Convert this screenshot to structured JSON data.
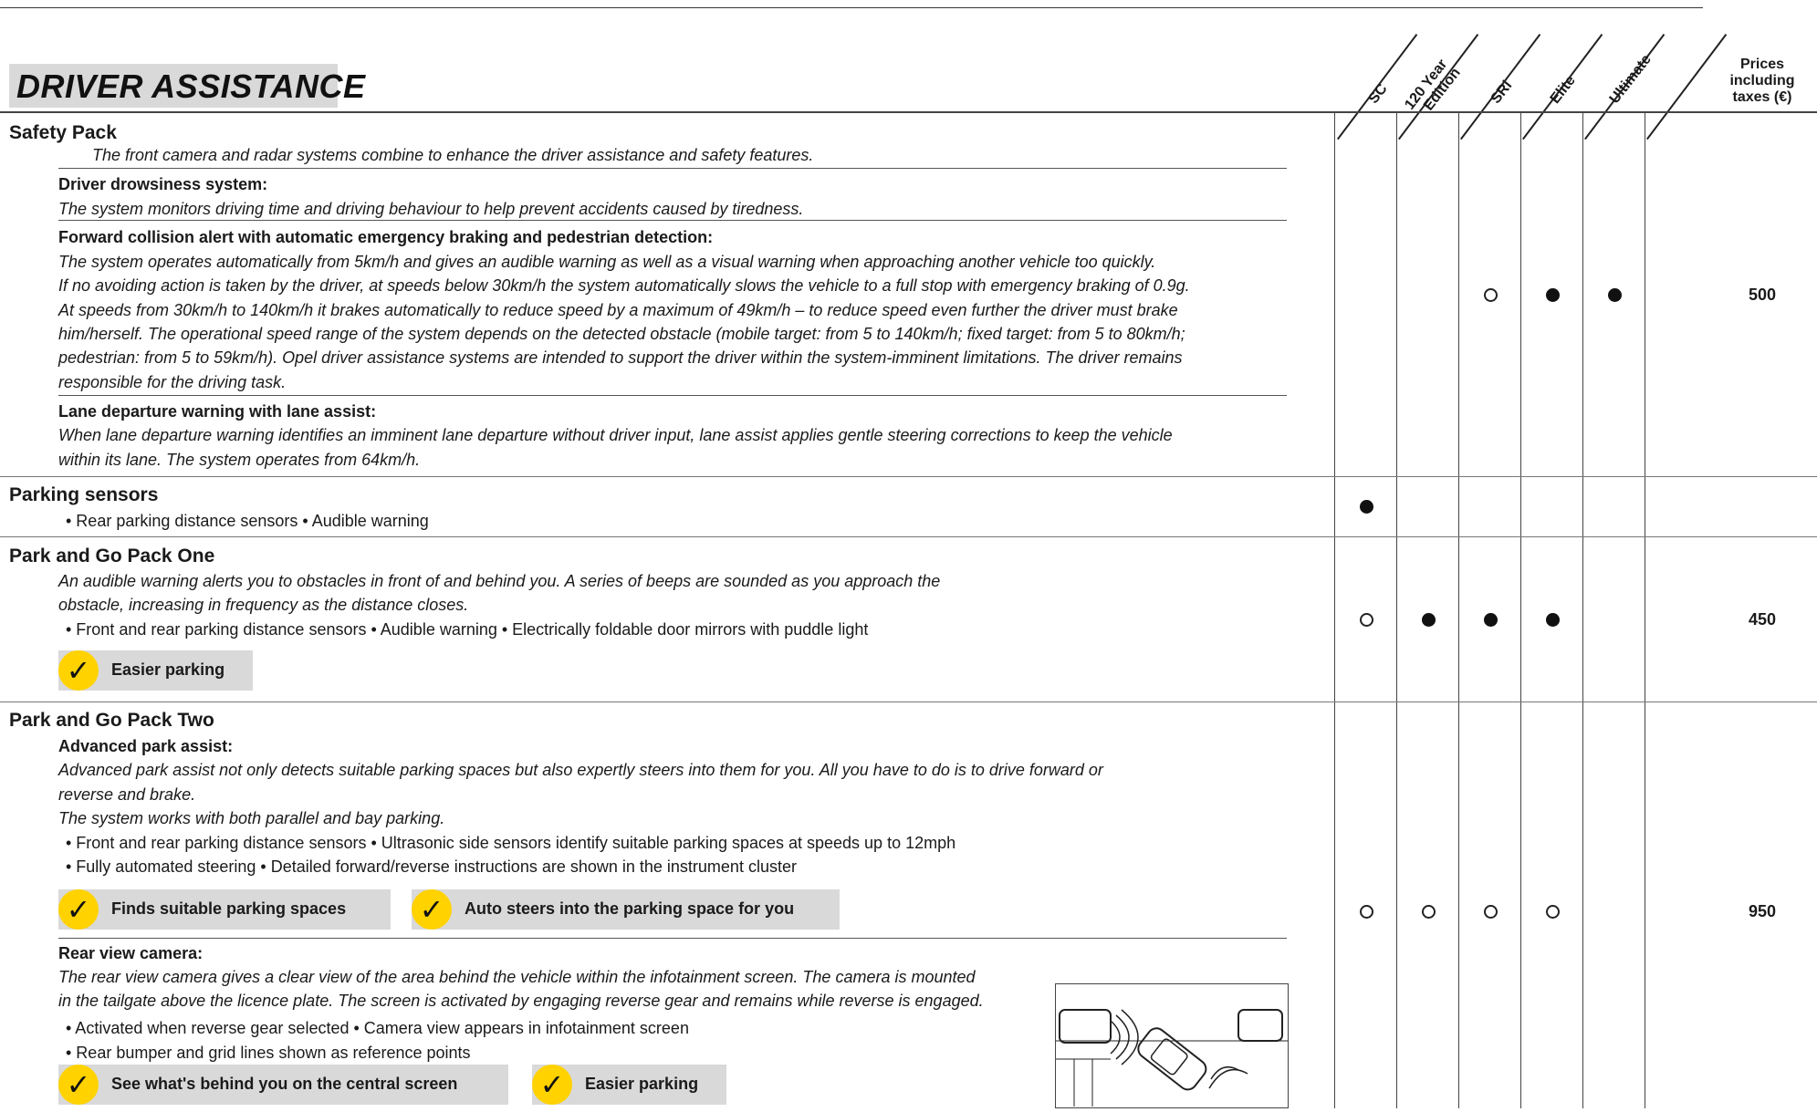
{
  "header": {
    "title": "DRIVER ASSISTANCE",
    "columns": [
      "SC",
      "120 Year Edition",
      "SRi",
      "Elite",
      "Ultimate"
    ],
    "col_120_line1": "120 Year",
    "col_120_line2": "Edition",
    "price_line1": "Prices",
    "price_line2": "including",
    "price_line3": "taxes (€)"
  },
  "safety_pack": {
    "title": "Safety Pack",
    "intro": "The front camera and radar systems combine to enhance the driver assistance and safety features.",
    "drowsiness_title": "Driver drowsiness system:",
    "drowsiness_desc": "The system monitors driving time and driving behaviour to help prevent accidents caused by tiredness.",
    "fca_title": "Forward collision alert with automatic emergency braking and pedestrian detection:",
    "fca_lines": [
      "The system operates automatically from 5km/h and gives an audible warning as well as a visual warning when approaching another vehicle too quickly.",
      "If no avoiding action is taken by the driver, at speeds below 30km/h the system automatically slows the vehicle to a full stop with emergency braking of 0.9g.",
      "At speeds from 30km/h to 140km/h it brakes automatically to reduce speed by a maximum of 49km/h – to reduce speed even further the driver must brake",
      "him/herself. The operational speed range of the system depends on the detected obstacle (mobile target: from 5 to 140km/h; fixed target: from 5 to 80km/h;",
      "pedestrian: from 5 to 59km/h). Opel driver assistance systems are intended to support the driver within the system-imminent limitations. The driver remains",
      "responsible for the driving task."
    ],
    "lane_title": "Lane departure warning with lane assist:",
    "lane_lines": [
      "When lane departure warning identifies an imminent lane departure without driver input, lane assist applies gentle steering corrections to keep the vehicle",
      "within its lane. The system operates from 64km/h."
    ],
    "availability": [
      "",
      "",
      "optional",
      "standard",
      "standard"
    ],
    "price": "500"
  },
  "parking_sensors": {
    "title": "Parking sensors",
    "bullets": "• Rear parking distance sensors  • Audible warning",
    "availability": [
      "standard",
      "",
      "",
      "",
      ""
    ],
    "price": ""
  },
  "park_go_one": {
    "title": "Park and Go Pack One",
    "desc_lines": [
      "An audible warning alerts you to obstacles in front of and behind you. A series of beeps are sounded as you approach the",
      "obstacle, increasing in frequency as the distance closes."
    ],
    "bullets": "• Front and rear parking distance sensors  • Audible warning  • Electrically foldable door mirrors with puddle light",
    "benefit": "Easier parking",
    "check": "✓",
    "availability": [
      "optional",
      "standard",
      "standard",
      "standard",
      ""
    ],
    "price": "450"
  },
  "park_go_two": {
    "title": "Park and Go Pack Two",
    "apa_title": "Advanced park assist:",
    "apa_lines": [
      "Advanced park assist not only detects suitable parking spaces but also expertly steers into them for you. All you have to do is to drive forward or",
      "reverse and brake.",
      "The system works with both parallel and bay parking."
    ],
    "apa_bullets": [
      "• Front and rear parking distance sensors  • Ultrasonic side sensors identify suitable parking spaces at speeds up to 12mph",
      "• Fully automated steering  • Detailed forward/reverse instructions are shown in the instrument cluster"
    ],
    "benefit1": "Finds suitable parking spaces",
    "benefit2": "Auto steers into the parking space for you",
    "camera_title": "Rear view camera:",
    "camera_lines": [
      "The rear view camera gives a clear view of the area behind the vehicle within the infotainment screen. The camera is mounted",
      "in the tailgate above the licence plate. The screen is activated by engaging reverse gear and remains while reverse is engaged."
    ],
    "camera_bullets": [
      "• Activated when reverse gear selected  • Camera view appears in infotainment screen",
      "• Rear bumper and grid lines shown as reference points"
    ],
    "benefit3": "See what's behind you on the central screen",
    "benefit4": "Easier parking",
    "check": "✓",
    "availability": [
      "optional",
      "optional",
      "optional",
      "optional",
      ""
    ],
    "price": "950"
  },
  "legend": {
    "standard": "●",
    "optional": "○"
  }
}
